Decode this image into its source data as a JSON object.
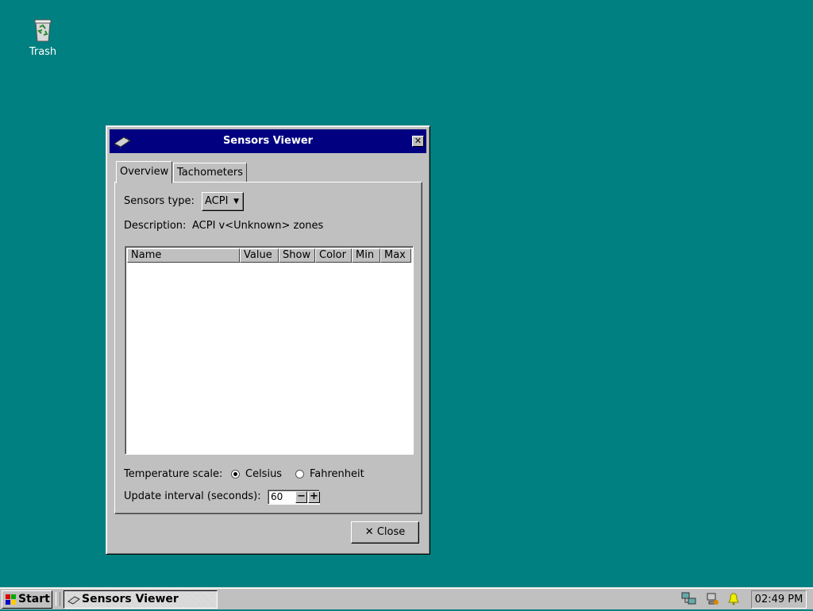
{
  "desktop": {
    "icons": [
      {
        "label": "Trash",
        "icon": "trash-icon"
      }
    ]
  },
  "window": {
    "title": "Sensors Viewer",
    "icon": "chip-icon",
    "close_glyph": "✕",
    "tabs": [
      {
        "label": "Overview",
        "active": true
      },
      {
        "label": "Tachometers",
        "active": false
      }
    ],
    "sensors_type": {
      "label": "Sensors type:",
      "value": "ACPI"
    },
    "description": {
      "label": "Description:",
      "value": "ACPI v<Unknown> zones"
    },
    "table": {
      "columns": [
        "Name",
        "Value",
        "Show",
        "Color",
        "Min",
        "Max"
      ],
      "rows": []
    },
    "temperature_scale": {
      "label": "Temperature scale:",
      "options": [
        {
          "label": "Celsius",
          "selected": true
        },
        {
          "label": "Fahrenheit",
          "selected": false
        }
      ]
    },
    "update_interval": {
      "label": "Update interval (seconds):",
      "value": "60",
      "minus": "−",
      "plus": "+"
    },
    "close_button": {
      "label": "Close",
      "glyph": "✕"
    }
  },
  "taskbar": {
    "start_label": "Start",
    "tasks": [
      {
        "label": "Sensors Viewer",
        "icon": "chip-icon",
        "active": true
      }
    ],
    "tray_icons": [
      "network-icon",
      "network-status-icon",
      "bell-icon"
    ],
    "clock": "02:49 PM"
  },
  "colors": {
    "desktop_bg": "#008080",
    "titlebar_bg": "#000080",
    "face": "#c0c0c0"
  }
}
